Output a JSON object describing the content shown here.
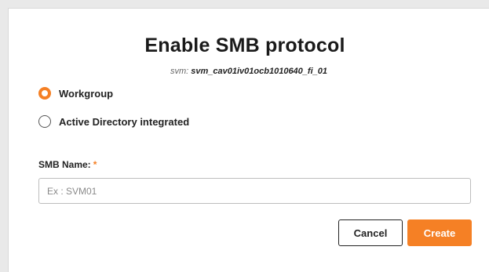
{
  "dialog": {
    "title": "Enable SMB protocol",
    "svm_prefix": "svm: ",
    "svm_name": "svm_cav01iv01ocb1010640_fi_01"
  },
  "options": [
    {
      "label": "Workgroup",
      "selected": true
    },
    {
      "label": "Active Directory integrated",
      "selected": false
    }
  ],
  "smb_name": {
    "label": "SMB Name:",
    "required_mark": "*",
    "value": "",
    "placeholder": "Ex : SVM01"
  },
  "actions": {
    "cancel_label": "Cancel",
    "create_label": "Create"
  },
  "colors": {
    "accent": "#f58025"
  }
}
